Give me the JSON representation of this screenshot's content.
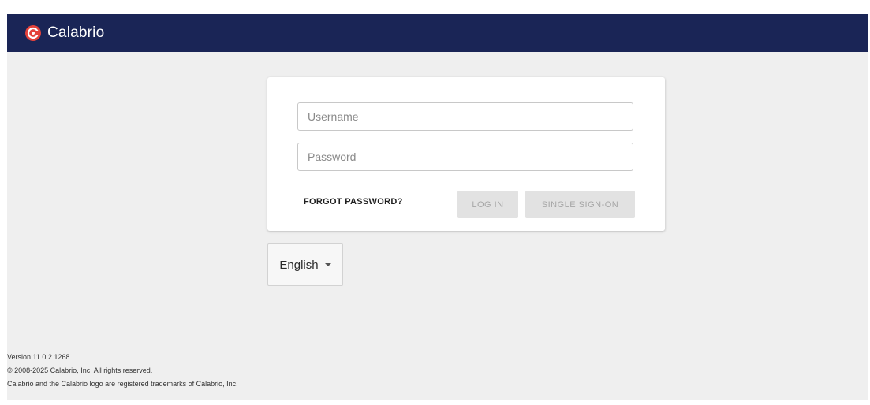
{
  "header": {
    "brand_name": "Calabrio",
    "logo_icon": "calabrio-logo-icon",
    "background_color": "#1a2556",
    "logo_color": "#e4423b"
  },
  "login_card": {
    "username_placeholder": "Username",
    "password_placeholder": "Password",
    "forgot_password_label": "FORGOT PASSWORD?",
    "login_button_label": "LOG IN",
    "sso_button_label": "SINGLE SIGN-ON"
  },
  "language_selector": {
    "selected": "English",
    "icon": "caret-down-icon"
  },
  "footer": {
    "version": "Version 11.0.2.1268",
    "copyright": "© 2008-2025 Calabrio, Inc. All rights reserved.",
    "trademark": "Calabrio and the Calabrio logo are registered trademarks of Calabrio, Inc."
  }
}
